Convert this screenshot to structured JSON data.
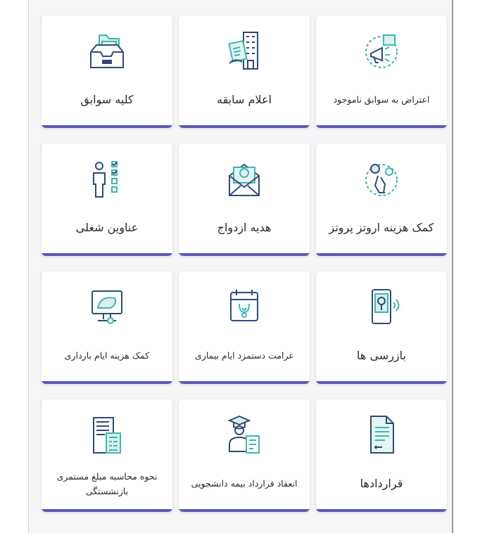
{
  "tiles": [
    {
      "label": "کلیه سوابق",
      "icon": "inbox-folder-icon",
      "size": "big"
    },
    {
      "label": "اعلام سابقه",
      "icon": "building-document-icon",
      "size": "big"
    },
    {
      "label": "اعتراض به سوابق ناموجود",
      "icon": "megaphone-protest-icon",
      "size": "small"
    },
    {
      "label": "عناوین شغلی",
      "icon": "person-checklist-icon",
      "size": "big"
    },
    {
      "label": "هدیه ازدواج",
      "icon": "envelope-gift-icon",
      "size": "big"
    },
    {
      "label": "کمک هزینه اروتز پروتز",
      "icon": "prosthetic-leg-icon",
      "size": "big"
    },
    {
      "label": "کمک هزینه ایام بارداری",
      "icon": "ultrasound-monitor-icon",
      "size": "small"
    },
    {
      "label": "غرامت دستمزد ایام بیماری",
      "icon": "calendar-stethoscope-icon",
      "size": "small"
    },
    {
      "label": "بازرسی ها",
      "icon": "inspection-phone-icon",
      "size": "big"
    },
    {
      "label": "نحوه محاسبه مبلغ مستمری بازنشستگی",
      "icon": "calculator-document-icon",
      "size": "small"
    },
    {
      "label": "انعقاد قرارداد بیمه دانشجویی",
      "icon": "graduate-contract-icon",
      "size": "small"
    },
    {
      "label": "قراردادها",
      "icon": "contract-document-icon",
      "size": "big"
    }
  ],
  "colors": {
    "accent": "#5b5bb5",
    "icon_blue": "#2f4a7a",
    "icon_teal": "#3fb6b0",
    "text": "#2a2a2a"
  }
}
